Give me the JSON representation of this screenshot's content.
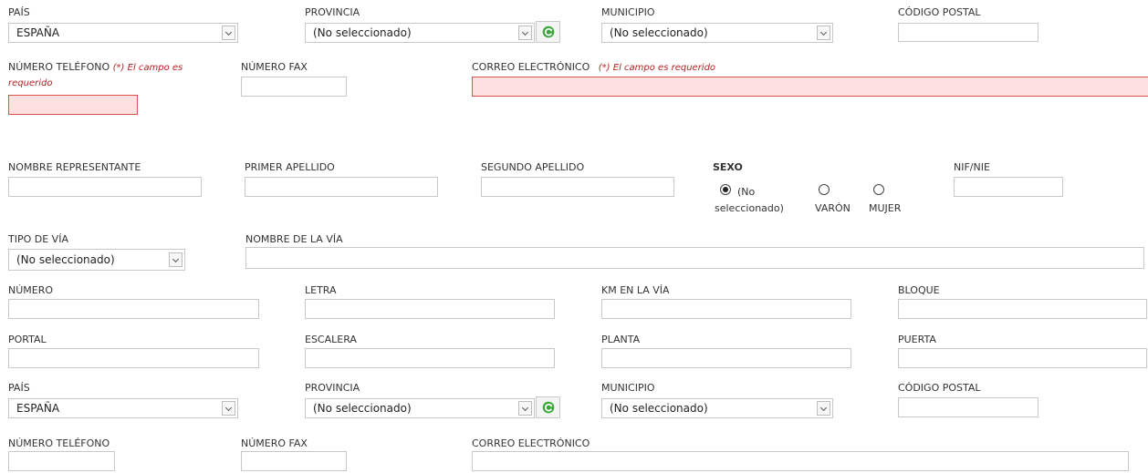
{
  "address1": {
    "pais_label": "PAÍS",
    "pais_value": "ESPAÑA",
    "provincia_label": "PROVINCIA",
    "provincia_value": "(No seleccionado)",
    "municipio_label": "MUNICIPIO",
    "municipio_value": "(No seleccionado)",
    "cp_label": "CÓDIGO POSTAL"
  },
  "contact1": {
    "tel_label": "NÚMERO TELÉFONO",
    "tel_req": "(*)  El campo es",
    "tel_req2": "requerido",
    "fax_label": "NÚMERO FAX",
    "email_label": "CORREO ELECTRÓNICO",
    "email_req": "(*)  El campo es requerido"
  },
  "representative": {
    "nombre_label": "NOMBRE REPRESENTANTE",
    "apellido1_label": "PRIMER APELLIDO",
    "apellido2_label": "SEGUNDO APELLIDO",
    "sexo_label": "SEXO",
    "sexo_options": [
      "(No",
      "seleccionado)",
      "VARÓN",
      "MUJER"
    ],
    "nif_label": "NIF/NIE"
  },
  "street": {
    "tipo_label": "TIPO DE VÍA",
    "tipo_value": "(No seleccionado)",
    "nombre_label": "NOMBRE DE LA VÍA",
    "numero_label": "NÚMERO",
    "letra_label": "LETRA",
    "km_label": "KM EN LA VÍA",
    "bloque_label": "BLOQUE",
    "portal_label": "PORTAL",
    "escalera_label": "ESCALERA",
    "planta_label": "PLANTA",
    "puerta_label": "PUERTA"
  },
  "address2": {
    "pais_label": "PAÍS",
    "pais_value": "ESPAÑA",
    "provincia_label": "PROVINCIA",
    "provincia_value": "(No seleccionado)",
    "municipio_label": "MUNICIPIO",
    "municipio_value": "(No seleccionado)",
    "cp_label": "CÓDIGO POSTAL"
  },
  "contact2": {
    "tel_label": "NÚMERO TELÉFONO",
    "fax_label": "NÚMERO FAX",
    "email_label": "CORREO ELECTRÓNICO"
  },
  "colors": {
    "error_border": "#d9534f",
    "error_bg": "#ffe0e0",
    "required_text": "#b22222"
  }
}
